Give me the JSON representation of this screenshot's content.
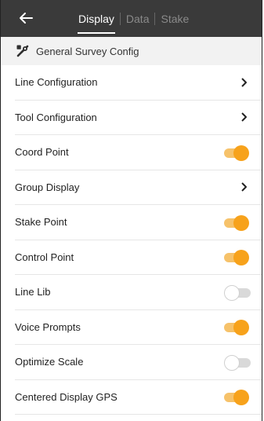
{
  "header": {
    "tabs": [
      {
        "label": "Display",
        "active": true
      },
      {
        "label": "Data",
        "active": false
      },
      {
        "label": "Stake",
        "active": false
      }
    ],
    "icons": {
      "back": "arrow-left-icon"
    }
  },
  "section": {
    "icon": "tools-icon",
    "title": "General Survey Config"
  },
  "items": [
    {
      "label": "Line Configuration",
      "control": "chevron"
    },
    {
      "label": "Tool Configuration",
      "control": "chevron"
    },
    {
      "label": "Coord Point",
      "control": "toggle",
      "on": true
    },
    {
      "label": "Group Display",
      "control": "chevron"
    },
    {
      "label": "Stake Point",
      "control": "toggle",
      "on": true
    },
    {
      "label": "Control Point",
      "control": "toggle",
      "on": true
    },
    {
      "label": "Line Lib",
      "control": "toggle",
      "on": false
    },
    {
      "label": "Voice Prompts",
      "control": "toggle",
      "on": true
    },
    {
      "label": "Optimize Scale",
      "control": "toggle",
      "on": false
    },
    {
      "label": "Centered Display GPS",
      "control": "toggle",
      "on": true
    }
  ],
  "colors": {
    "accent": "#f7a21b",
    "topbar": "#3a3a3a"
  }
}
